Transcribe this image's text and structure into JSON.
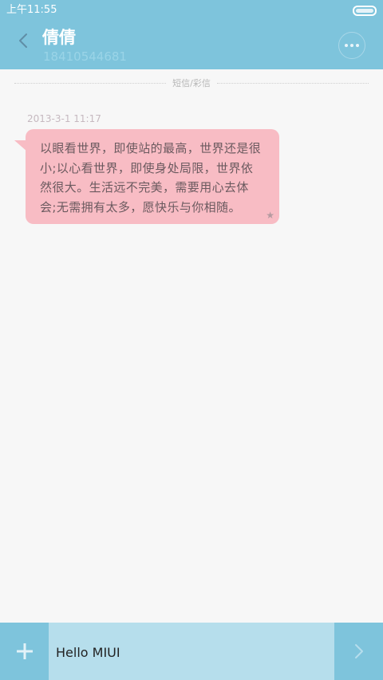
{
  "status_bar": {
    "time": "上午11:55"
  },
  "header": {
    "contact_name": "倩倩",
    "contact_number": "18410544681",
    "back_icon": "chevron-left-icon",
    "more_icon": "more-dots-icon"
  },
  "conversation": {
    "divider_label": "短信/彩信",
    "messages": [
      {
        "timestamp": "2013-3-1 11:17",
        "text": "以眼看世界，即使站的最高，世界还是很小;以心看世界，即使身处局限，世界依然很大。生活远不完美，需要用心去体会;无需拥有太多，愿快乐与你相随。",
        "starred": true,
        "star_icon": "star-icon"
      }
    ]
  },
  "composer": {
    "input_value": "Hello MIUI",
    "add_icon": "plus-icon",
    "send_icon": "chevron-right-icon"
  },
  "colors": {
    "accent": "#7ec4dc",
    "input_bg": "#b6deec",
    "bubble": "#f8bcc4"
  }
}
